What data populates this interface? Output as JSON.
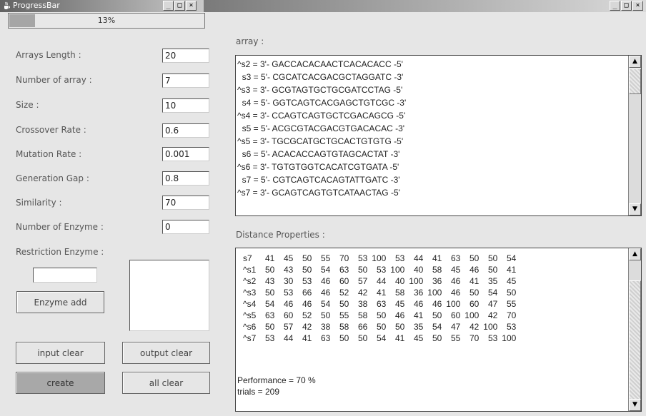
{
  "progress_window": {
    "title": "ProgressBar",
    "percent_text": "13%",
    "progress_fraction": 0.13
  },
  "window_buttons": {
    "minimize": "_",
    "maximize": "□",
    "close": "×"
  },
  "form": {
    "arrays_length": {
      "label": "Arrays Length :",
      "value": "20"
    },
    "number_of_array": {
      "label": "Number of array :",
      "value": "7"
    },
    "size": {
      "label": "Size :",
      "value": "10"
    },
    "crossover_rate": {
      "label": "Crossover Rate :",
      "value": "0.6"
    },
    "mutation_rate": {
      "label": "Mutation Rate :",
      "value": "0.001"
    },
    "generation_gap": {
      "label": "Generation Gap :",
      "value": "0.8"
    },
    "similarity": {
      "label": "Similarity :",
      "value": "70"
    },
    "number_of_enzyme": {
      "label": "Number of Enzyme :",
      "value": "0"
    },
    "restriction_enzyme": {
      "label": "Restriction Enzyme  :",
      "value": ""
    }
  },
  "buttons": {
    "enzyme_add": "Enzyme add",
    "input_clear": "input clear",
    "output_clear": "output clear",
    "create": "create",
    "all_clear": "all clear"
  },
  "array_panel": {
    "label": "array :",
    "lines": [
      "^s2 = 3'- GACCACACAACTCACACACC -5'",
      "  s3 = 5'- CGCATCACGACGCTAGGATC -3'",
      "^s3 = 3'- GCGTAGTGCTGCGATCCTAG -5'",
      "  s4 = 5'- GGTCAGTCACGAGCTGTCGC -3'",
      "^s4 = 3'- CCAGTCAGTGCTCGACAGCG -5'",
      "  s5 = 5'- ACGCGTACGACGTGACACAC -3'",
      "^s5 = 3'- TGCGCATGCTGCACTGTGTG -5'",
      "  s6 = 5'- ACACACCAGTGTAGCACTAT -3'",
      "^s6 = 3'- TGTGTGGTCACATCGTGATA -5'",
      "  s7 = 5'- CGTCAGTCACAGTATTGATC -3'",
      "^s7 = 3'- GCAGTCAGTGTCATAACTAG -5'"
    ]
  },
  "distance_panel": {
    "label": "Distance Properties :",
    "rows": [
      {
        "name": "s7",
        "values": [
          "41",
          "45",
          "50",
          "55",
          "70",
          "53",
          "100",
          "53",
          "44",
          "41",
          "63",
          "50",
          "50",
          "54"
        ]
      },
      {
        "name": "^s1",
        "values": [
          "50",
          "43",
          "50",
          "54",
          "63",
          "50",
          "53",
          "100",
          "40",
          "58",
          "45",
          "46",
          "50",
          "41"
        ]
      },
      {
        "name": "^s2",
        "values": [
          "43",
          "30",
          "53",
          "46",
          "60",
          "57",
          "44",
          "40",
          "100",
          "36",
          "46",
          "41",
          "35",
          "45"
        ]
      },
      {
        "name": "^s3",
        "values": [
          "50",
          "53",
          "66",
          "46",
          "52",
          "42",
          "41",
          "58",
          "36",
          "100",
          "46",
          "50",
          "54",
          "50"
        ]
      },
      {
        "name": "^s4",
        "values": [
          "54",
          "46",
          "46",
          "54",
          "50",
          "38",
          "63",
          "45",
          "46",
          "46",
          "100",
          "60",
          "47",
          "55"
        ]
      },
      {
        "name": "^s5",
        "values": [
          "63",
          "60",
          "52",
          "50",
          "55",
          "58",
          "50",
          "46",
          "41",
          "50",
          "60",
          "100",
          "42",
          "70"
        ]
      },
      {
        "name": "^s6",
        "values": [
          "50",
          "57",
          "42",
          "38",
          "58",
          "66",
          "50",
          "50",
          "35",
          "54",
          "47",
          "42",
          "100",
          "53"
        ]
      },
      {
        "name": "^s7",
        "values": [
          "53",
          "44",
          "41",
          "63",
          "50",
          "50",
          "54",
          "41",
          "45",
          "50",
          "55",
          "70",
          "53",
          "100"
        ]
      }
    ],
    "performance": "Performance = 70 %",
    "trials": "trials = 209"
  },
  "colors": {
    "background": "#e6e6e6",
    "pressed_button": "#a8a8a8",
    "progress_fill": "#a6a6a6"
  }
}
